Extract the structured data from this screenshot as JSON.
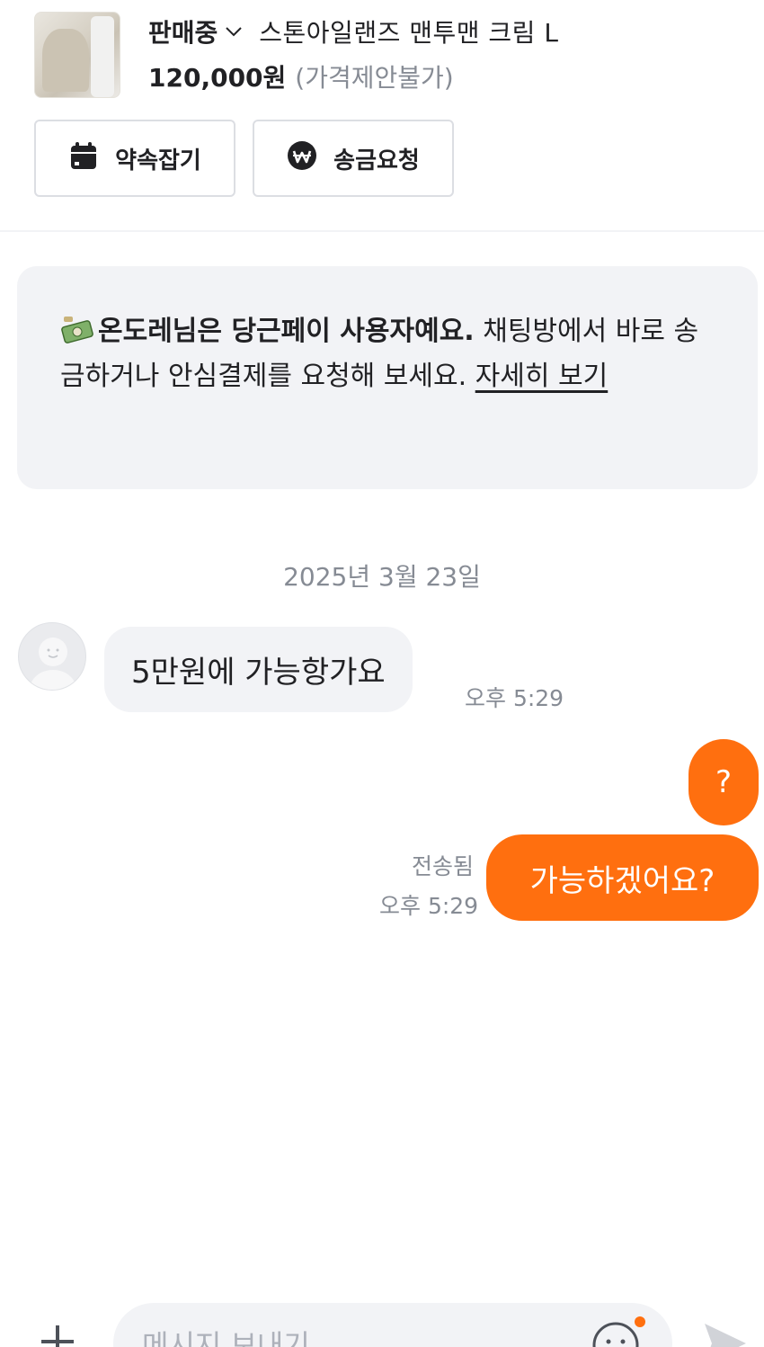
{
  "product": {
    "status": "판매중",
    "title": "스톤아일랜즈 맨투맨 크림 L",
    "price": "120,000원",
    "price_note": "(가격제안불가)"
  },
  "actions": {
    "appointment_label": "약속잡기",
    "payment_request_label": "송금요청"
  },
  "banner": {
    "bold_text": "온도레님은 당근페이 사용자예요.",
    "body_text": " 채팅방에서 바로 송금하거나 안심결제를 요청해 보세요. ",
    "link_text": "자세히 보기"
  },
  "chat": {
    "date": "2025년 3월 23일",
    "messages": [
      {
        "direction": "in",
        "text": "5만원에 가능항가요",
        "time": "오후 5:29"
      },
      {
        "direction": "out",
        "text": "?"
      },
      {
        "direction": "out",
        "text": "가능하겠어요?",
        "status": "전송됨",
        "time": "오후 5:29"
      }
    ]
  },
  "composer": {
    "placeholder": "메시지 보내기"
  },
  "colors": {
    "accent": "#ff6f0f",
    "bubble_in": "#f2f3f6",
    "muted_text": "#868b94"
  }
}
